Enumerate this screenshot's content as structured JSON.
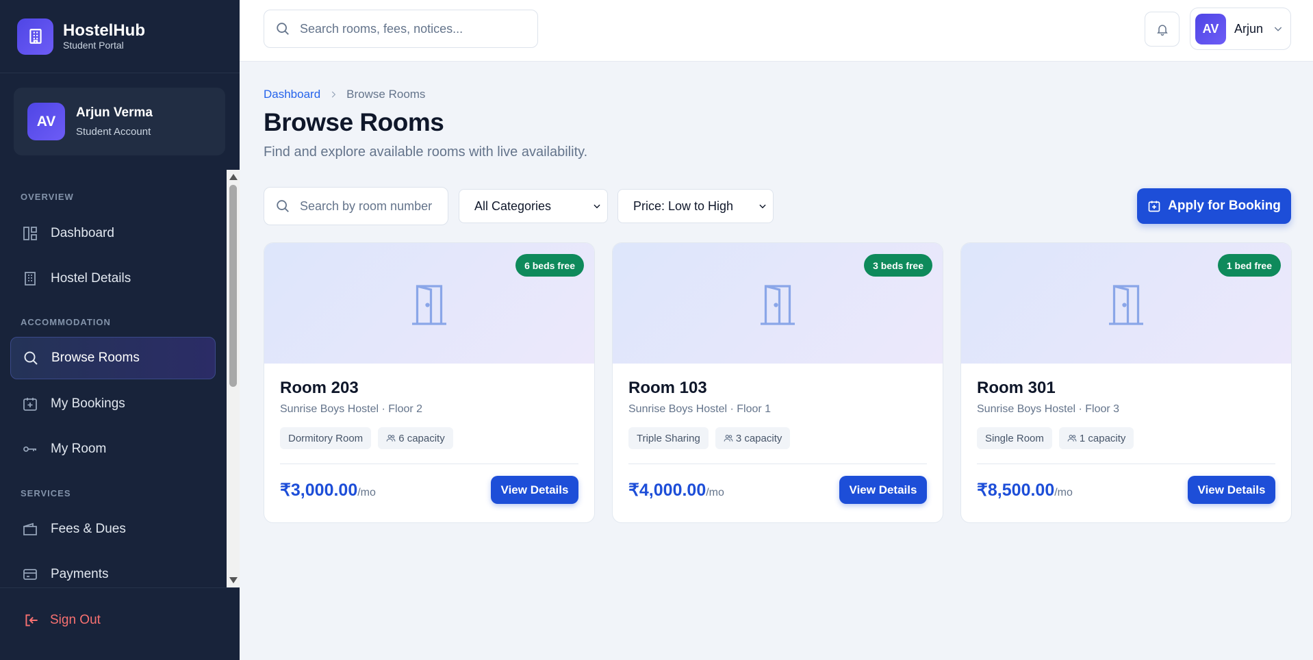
{
  "brand": {
    "name": "HostelHub",
    "subtitle": "Student Portal"
  },
  "user": {
    "initials": "AV",
    "name": "Arjun Verma",
    "role": "Student Account",
    "short_name": "Arjun"
  },
  "sidebar": {
    "sections": [
      {
        "label": "OVERVIEW"
      },
      {
        "label": "ACCOMMODATION"
      },
      {
        "label": "SERVICES"
      }
    ],
    "items": [
      {
        "label": "Dashboard",
        "icon": "dashboard-icon"
      },
      {
        "label": "Hostel Details",
        "icon": "building-icon"
      },
      {
        "label": "Browse Rooms",
        "icon": "search-icon",
        "active": true
      },
      {
        "label": "My Bookings",
        "icon": "calendar-plus-icon"
      },
      {
        "label": "My Room",
        "icon": "key-icon"
      },
      {
        "label": "Fees & Dues",
        "icon": "wallet-icon"
      },
      {
        "label": "Payments",
        "icon": "credit-card-icon"
      }
    ],
    "sign_out": "Sign Out"
  },
  "topbar": {
    "search_placeholder": "Search rooms, fees, notices..."
  },
  "breadcrumb": {
    "parent": "Dashboard",
    "current": "Browse Rooms"
  },
  "page": {
    "title": "Browse Rooms",
    "subtitle": "Find and explore available rooms with live availability."
  },
  "filters": {
    "search_placeholder": "Search by room number",
    "category": "All Categories",
    "sort": "Price: Low to High",
    "apply_label": "Apply for Booking"
  },
  "rooms": [
    {
      "name": "Room 203",
      "location": "Sunrise Boys Hostel · Floor 2",
      "type": "Dormitory Room",
      "capacity": "6 capacity",
      "badge": "6 beds free",
      "price": "₹3,000.00",
      "per": "/mo",
      "action": "View Details"
    },
    {
      "name": "Room 103",
      "location": "Sunrise Boys Hostel · Floor 1",
      "type": "Triple Sharing",
      "capacity": "3 capacity",
      "badge": "3 beds free",
      "price": "₹4,000.00",
      "per": "/mo",
      "action": "View Details"
    },
    {
      "name": "Room 301",
      "location": "Sunrise Boys Hostel · Floor 3",
      "type": "Single Room",
      "capacity": "1 capacity",
      "badge": "1 bed free",
      "price": "₹8,500.00",
      "per": "/mo",
      "action": "View Details"
    }
  ],
  "colors": {
    "primary": "#1d4ed8",
    "sidebar_bg": "#18233a",
    "badge_green": "#0e8a5b",
    "danger": "#f87171"
  }
}
